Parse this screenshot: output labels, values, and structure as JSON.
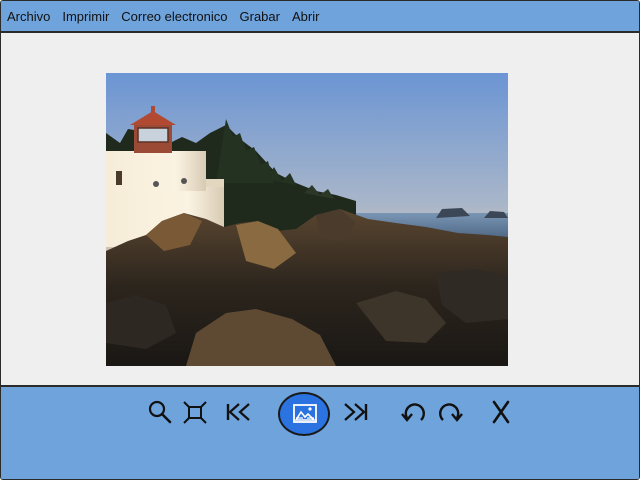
{
  "menubar": {
    "items": [
      {
        "label": "Archivo"
      },
      {
        "label": "Imprimir"
      },
      {
        "label": "Correo electronico"
      },
      {
        "label": "Grabar"
      },
      {
        "label": "Abrir"
      }
    ]
  },
  "viewer": {
    "photo": {
      "subject": "lighthouse-on-rocky-shore-at-sunset"
    }
  },
  "toolbar": {
    "tools": [
      {
        "name": "zoom-button",
        "icon": "magnifier-icon"
      },
      {
        "name": "fit-to-screen-button",
        "icon": "fit-screen-icon"
      },
      {
        "name": "previous-button",
        "icon": "skip-back-icon"
      },
      {
        "name": "slideshow-button",
        "icon": "image-icon",
        "active": true
      },
      {
        "name": "next-button",
        "icon": "skip-forward-icon"
      },
      {
        "name": "rotate-left-button",
        "icon": "rotate-left-icon"
      },
      {
        "name": "rotate-right-button",
        "icon": "rotate-right-icon"
      },
      {
        "name": "delete-button",
        "icon": "x-icon"
      }
    ]
  },
  "colors": {
    "chrome": "#6fa3dc",
    "active": "#2a73e0",
    "canvas": "#efefef"
  }
}
